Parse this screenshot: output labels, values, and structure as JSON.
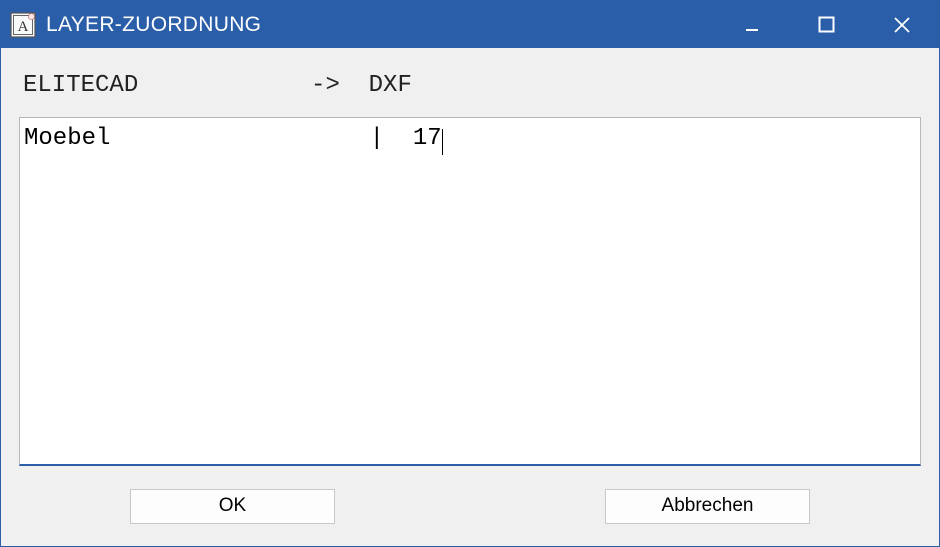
{
  "window": {
    "title": "LAYER-ZUORDNUNG"
  },
  "header": {
    "line": "ELITECAD            ->  DXF"
  },
  "content": {
    "line1": "Moebel                  |  17"
  },
  "buttons": {
    "ok": "OK",
    "cancel": "Abbrechen"
  },
  "icons": {
    "app": "A"
  }
}
